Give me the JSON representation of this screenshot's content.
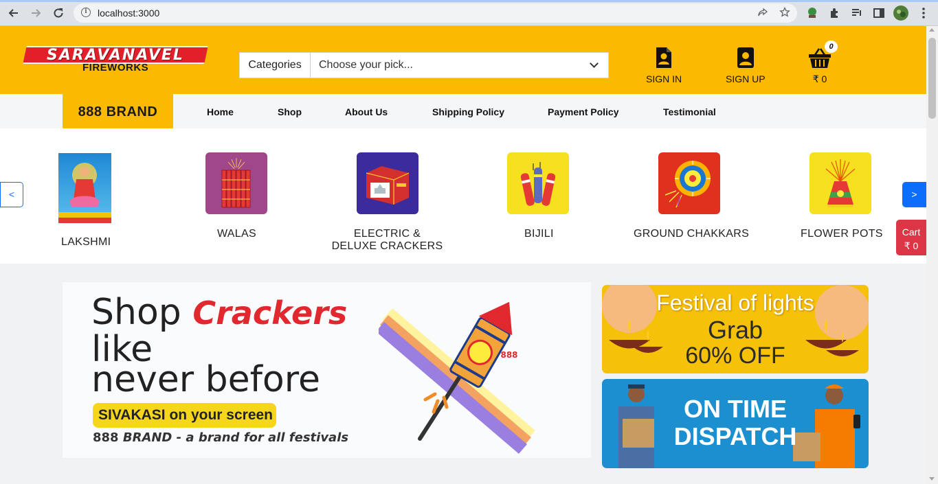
{
  "browser": {
    "url": "localhost:3000"
  },
  "header": {
    "logo_main": "SARAVANAVEL",
    "logo_sub": "FIREWORKS",
    "categories_label": "Categories",
    "category_select": "Choose your pick...",
    "sign_in": "SIGN IN",
    "sign_up": "SIGN UP",
    "cart_count": "0",
    "cart_total": "₹ 0"
  },
  "nav": {
    "brand": "888 BRAND",
    "items": [
      "Home",
      "Shop",
      "About Us",
      "Shipping Policy",
      "Payment Policy",
      "Testimonial"
    ]
  },
  "categories": {
    "prev": "<",
    "next": ">",
    "items": [
      {
        "label": "LAKSHMI"
      },
      {
        "label": "WALAS"
      },
      {
        "label": "ELECTRIC & DELUXE CRACKERS"
      },
      {
        "label": "BIJILI"
      },
      {
        "label": "GROUND CHAKKARS"
      },
      {
        "label": "FLOWER POTS"
      }
    ]
  },
  "side_cart": {
    "label": "Cart",
    "total": "₹ 0"
  },
  "banners": {
    "main": {
      "shop": "Shop",
      "crackers": "Crackers",
      "line2": "like",
      "line3": "never before",
      "pill": "SIVAKASI on your screen",
      "tag_brand": "888",
      "tag_brand2": "BRAND",
      "tag_rest": "- a brand for all festivals",
      "rocket_badge": "888"
    },
    "festival": {
      "title": "Festival of lights",
      "grab": "Grab",
      "offer": "60% OFF"
    },
    "dispatch": {
      "line1": "ON TIME",
      "line2": "DISPATCH"
    }
  },
  "colors": {
    "brand_yellow": "#fbba00",
    "brand_red": "#e3202a",
    "accent_blue": "#0d6efd",
    "cart_red": "#dc3545"
  }
}
